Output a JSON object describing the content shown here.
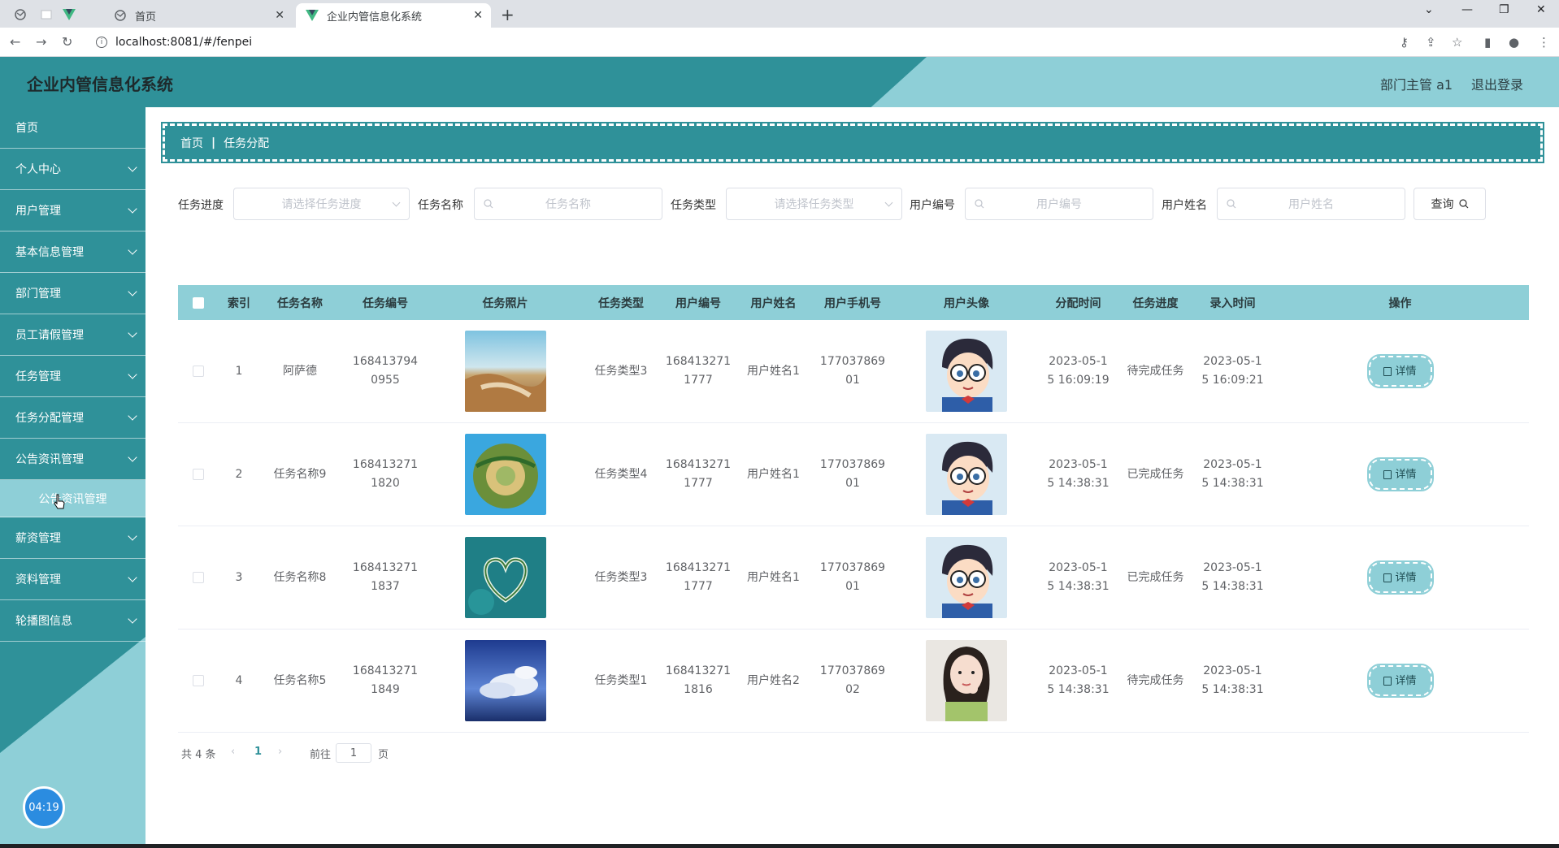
{
  "browser": {
    "tabs": [
      {
        "title": "首页",
        "active": false
      },
      {
        "title": "企业内管信息化系统",
        "active": true
      }
    ],
    "url": "localhost:8081/#/fenpei"
  },
  "header": {
    "title": "企业内管信息化系统",
    "user": "部门主管 a1",
    "logout": "退出登录"
  },
  "sidebar": {
    "items": [
      {
        "label": "首页",
        "has_arrow": false
      },
      {
        "label": "个人中心",
        "has_arrow": true
      },
      {
        "label": "用户管理",
        "has_arrow": true
      },
      {
        "label": "基本信息管理",
        "has_arrow": true
      },
      {
        "label": "部门管理",
        "has_arrow": true
      },
      {
        "label": "员工请假管理",
        "has_arrow": true
      },
      {
        "label": "任务管理",
        "has_arrow": true
      },
      {
        "label": "任务分配管理",
        "has_arrow": true
      },
      {
        "label": "公告资讯管理",
        "has_arrow": true
      },
      {
        "label": "薪资管理",
        "has_arrow": true
      },
      {
        "label": "资料管理",
        "has_arrow": true
      },
      {
        "label": "轮播图信息",
        "has_arrow": true
      }
    ],
    "submenu_item": "公告资讯管理",
    "clock": "04:19"
  },
  "breadcrumb": {
    "home": "首页",
    "current": "任务分配"
  },
  "search": {
    "progress_label": "任务进度",
    "progress_placeholder": "请选择任务进度",
    "name_label": "任务名称",
    "name_placeholder": "任务名称",
    "type_label": "任务类型",
    "type_placeholder": "请选择任务类型",
    "userno_label": "用户编号",
    "userno_placeholder": "用户编号",
    "username_label": "用户姓名",
    "username_placeholder": "用户姓名",
    "query_button": "查询"
  },
  "table": {
    "headers": {
      "index": "索引",
      "name": "任务名称",
      "no": "任务编号",
      "photo": "任务照片",
      "type": "任务类型",
      "userno": "用户编号",
      "username": "用户姓名",
      "phone": "用户手机号",
      "avatar": "用户头像",
      "assign_time": "分配时间",
      "progress": "任务进度",
      "entry_time": "录入时间",
      "action": "操作"
    },
    "rows": [
      {
        "index": "1",
        "name": "阿萨德",
        "no_l1": "168413794",
        "no_l2": "0955",
        "photo": "landscape-image",
        "type": "任务类型3",
        "userno_l1": "168413271",
        "userno_l2": "1777",
        "username": "用户姓名1",
        "phone_l1": "177037869",
        "phone_l2": "01",
        "avatar": "cartoon-avatar-image",
        "assign_l1": "2023-05-1",
        "assign_l2": "5 16:09:19",
        "progress": "待完成任务",
        "entry_l1": "2023-05-1",
        "entry_l2": "5 16:09:21",
        "action": "详情"
      },
      {
        "index": "2",
        "name": "任务名称9",
        "no_l1": "168413271",
        "no_l2": "1820",
        "photo": "planet-image",
        "type": "任务类型4",
        "userno_l1": "168413271",
        "userno_l2": "1777",
        "username": "用户姓名1",
        "phone_l1": "177037869",
        "phone_l2": "01",
        "avatar": "cartoon-avatar-image",
        "assign_l1": "2023-05-1",
        "assign_l2": "5 14:38:31",
        "progress": "已完成任务",
        "entry_l1": "2023-05-1",
        "entry_l2": "5 14:38:31",
        "action": "详情"
      },
      {
        "index": "3",
        "name": "任务名称8",
        "no_l1": "168413271",
        "no_l2": "1837",
        "photo": "heart-island-image",
        "type": "任务类型3",
        "userno_l1": "168413271",
        "userno_l2": "1777",
        "username": "用户姓名1",
        "phone_l1": "177037869",
        "phone_l2": "01",
        "avatar": "cartoon-avatar-image",
        "assign_l1": "2023-05-1",
        "assign_l2": "5 14:38:31",
        "progress": "已完成任务",
        "entry_l1": "2023-05-1",
        "entry_l2": "5 14:38:31",
        "action": "详情"
      },
      {
        "index": "4",
        "name": "任务名称5",
        "no_l1": "168413271",
        "no_l2": "1849",
        "photo": "sky-image",
        "type": "任务类型1",
        "userno_l1": "168413271",
        "userno_l2": "1816",
        "username": "用户姓名2",
        "phone_l1": "177037869",
        "phone_l2": "02",
        "avatar": "girl-avatar-image",
        "assign_l1": "2023-05-1",
        "assign_l2": "5 14:38:31",
        "progress": "待完成任务",
        "entry_l1": "2023-05-1",
        "entry_l2": "5 14:38:31",
        "action": "详情"
      }
    ]
  },
  "pagination": {
    "total": "共 4 条",
    "current_page": "1",
    "goto_prefix": "前往",
    "goto_value": "1",
    "goto_suffix": "页"
  },
  "colors": {
    "primary_dark": "#2f9199",
    "primary_light": "#8ecfd7"
  }
}
